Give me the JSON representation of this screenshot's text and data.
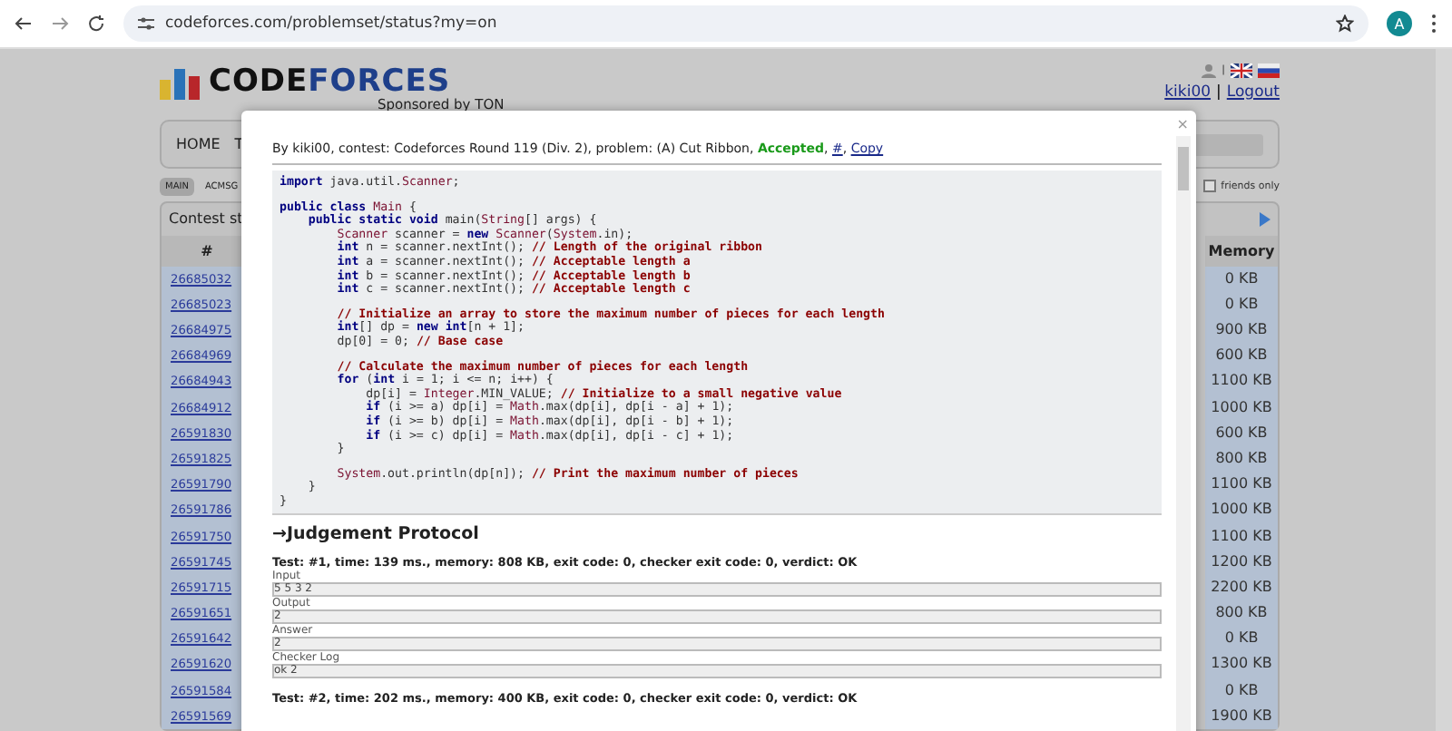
{
  "browser": {
    "url": "codeforces.com/problemset/status?my=on",
    "avatar": "A"
  },
  "site": {
    "logo_code": "CODE",
    "logo_forces": "FORCES",
    "sponsor": "Sponsored by TON",
    "user": "kiki00",
    "separator": "|",
    "logout": "Logout",
    "lang_separator": "|"
  },
  "nav": {
    "items": [
      "HOME",
      "T"
    ]
  },
  "filter": {
    "label": "friends only",
    "checked": false
  },
  "tabs": [
    {
      "label": "MAIN",
      "selected": true
    },
    {
      "label": "ACMSG",
      "selected": false
    }
  ],
  "table": {
    "caption": "Contest st",
    "columns": [
      "#",
      "Memory"
    ],
    "rows": [
      [
        "26685032",
        "0 KB"
      ],
      [
        "26685023",
        "0 KB"
      ],
      [
        "26684975",
        "900 KB"
      ],
      [
        "26684969",
        "600 KB"
      ],
      [
        "26684943",
        "1100 KB"
      ],
      [
        "26684912",
        "1000 KB"
      ],
      [
        "26591830",
        "600 KB"
      ],
      [
        "26591825",
        "800 KB"
      ],
      [
        "26591790",
        "1100 KB"
      ],
      [
        "26591786",
        "1000 KB"
      ],
      [
        "26591750",
        "1100 KB"
      ],
      [
        "26591745",
        "1200 KB"
      ],
      [
        "26591715",
        "2200 KB"
      ],
      [
        "26591651",
        "800 KB"
      ],
      [
        "26591642",
        "0 KB"
      ],
      [
        "26591620",
        "1300 KB"
      ],
      [
        "26591584",
        "0 KB"
      ],
      [
        "26591569",
        "1900 KB"
      ]
    ]
  },
  "modal": {
    "close": "×",
    "info": [
      {
        "text": "By kiki00, contest: Codeforces Round 119 (Div. 2), problem: (A) Cut Ribbon, ",
        "kind": "plain"
      },
      {
        "text": "Accepted",
        "kind": "verdict"
      },
      {
        "text": ", ",
        "kind": "plain"
      },
      {
        "text": "#",
        "kind": "link"
      },
      {
        "text": ", ",
        "kind": "plain"
      },
      {
        "text": "Copy",
        "kind": "link"
      }
    ],
    "code": [
      [
        [
          {
            "kind": "keyword",
            "text": "import"
          },
          {
            "kind": "plain",
            "text": " java.util."
          },
          {
            "kind": "type",
            "text": "Scanner"
          },
          {
            "kind": "plain",
            "text": ";"
          }
        ]
      ],
      [
        [
          {
            "kind": "keyword",
            "text": "public class"
          },
          {
            "kind": "type",
            "text": " Main"
          },
          {
            "kind": "plain",
            "text": " {"
          }
        ],
        [
          {
            "kind": "keyword",
            "text": "    public static void"
          },
          {
            "kind": "plain",
            "text": " main("
          },
          {
            "kind": "type",
            "text": "String"
          },
          {
            "kind": "plain",
            "text": "[] args) {"
          }
        ],
        [
          {
            "kind": "type",
            "text": "        Scanner"
          },
          {
            "kind": "plain",
            "text": " scanner = "
          },
          {
            "kind": "keyword",
            "text": "new"
          },
          {
            "kind": "type",
            "text": " Scanner"
          },
          {
            "kind": "plain",
            "text": "("
          },
          {
            "kind": "type",
            "text": "System"
          },
          {
            "kind": "plain",
            "text": ".in);"
          }
        ],
        [
          {
            "kind": "keyword",
            "text": "        int"
          },
          {
            "kind": "plain",
            "text": " n = scanner.nextInt(); "
          },
          {
            "kind": "comment",
            "text": "// Length of the original ribbon"
          }
        ],
        [
          {
            "kind": "keyword",
            "text": "        int"
          },
          {
            "kind": "plain",
            "text": " a = scanner.nextInt(); "
          },
          {
            "kind": "comment",
            "text": "// Acceptable length a"
          }
        ],
        [
          {
            "kind": "keyword",
            "text": "        int"
          },
          {
            "kind": "plain",
            "text": " b = scanner.nextInt(); "
          },
          {
            "kind": "comment",
            "text": "// Acceptable length b"
          }
        ],
        [
          {
            "kind": "keyword",
            "text": "        int"
          },
          {
            "kind": "plain",
            "text": " c = scanner.nextInt(); "
          },
          {
            "kind": "comment",
            "text": "// Acceptable length c"
          }
        ]
      ],
      [
        [
          {
            "kind": "comment",
            "text": "        // Initialize an array to store the maximum number of pieces for each length"
          }
        ],
        [
          {
            "kind": "keyword",
            "text": "        int"
          },
          {
            "kind": "plain",
            "text": "[] dp = "
          },
          {
            "kind": "keyword",
            "text": "new int"
          },
          {
            "kind": "plain",
            "text": "[n + 1];"
          }
        ],
        [
          {
            "kind": "plain",
            "text": "        dp[0] = 0; "
          },
          {
            "kind": "comment",
            "text": "// Base case"
          }
        ]
      ],
      [
        [
          {
            "kind": "comment",
            "text": "        // Calculate the maximum number of pieces for each length"
          }
        ],
        [
          {
            "kind": "keyword",
            "text": "        for"
          },
          {
            "kind": "plain",
            "text": " ("
          },
          {
            "kind": "keyword",
            "text": "int"
          },
          {
            "kind": "plain",
            "text": " i = 1; i <= n; i++) {"
          }
        ],
        [
          {
            "kind": "plain",
            "text": "            dp[i] = "
          },
          {
            "kind": "type",
            "text": "Integer"
          },
          {
            "kind": "plain",
            "text": ".MIN_VALUE; "
          },
          {
            "kind": "comment",
            "text": "// Initialize to a small negative value"
          }
        ],
        [
          {
            "kind": "keyword",
            "text": "            if"
          },
          {
            "kind": "plain",
            "text": " (i >= a) dp[i] = "
          },
          {
            "kind": "type",
            "text": "Math"
          },
          {
            "kind": "plain",
            "text": ".max(dp[i], dp[i - a] + 1);"
          }
        ],
        [
          {
            "kind": "keyword",
            "text": "            if"
          },
          {
            "kind": "plain",
            "text": " (i >= b) dp[i] = "
          },
          {
            "kind": "type",
            "text": "Math"
          },
          {
            "kind": "plain",
            "text": ".max(dp[i], dp[i - b] + 1);"
          }
        ],
        [
          {
            "kind": "keyword",
            "text": "            if"
          },
          {
            "kind": "plain",
            "text": " (i >= c) dp[i] = "
          },
          {
            "kind": "type",
            "text": "Math"
          },
          {
            "kind": "plain",
            "text": ".max(dp[i], dp[i - c] + 1);"
          }
        ],
        [
          {
            "kind": "plain",
            "text": "        }"
          }
        ]
      ],
      [
        [
          {
            "kind": "type",
            "text": "        System"
          },
          {
            "kind": "plain",
            "text": ".out.println(dp[n]); "
          },
          {
            "kind": "comment",
            "text": "// Print the maximum number of pieces"
          }
        ],
        [
          {
            "kind": "plain",
            "text": "    }"
          }
        ],
        [
          {
            "kind": "plain",
            "text": "}"
          }
        ]
      ]
    ],
    "protocol_title": "→Judgement Protocol",
    "tests": [
      {
        "heading": "Test: #1, time: 139 ms., memory: 808 KB, exit code: 0, checker exit code: 0, verdict: OK",
        "fields": [
          {
            "label": "Input",
            "value": "5 5 3 2"
          },
          {
            "label": "Output",
            "value": "2"
          },
          {
            "label": "Answer",
            "value": "2"
          },
          {
            "label": "Checker Log",
            "value": "ok 2"
          }
        ]
      },
      {
        "heading": "Test: #2, time: 202 ms., memory: 400 KB, exit code: 0, checker exit code: 0, verdict: OK"
      }
    ]
  }
}
